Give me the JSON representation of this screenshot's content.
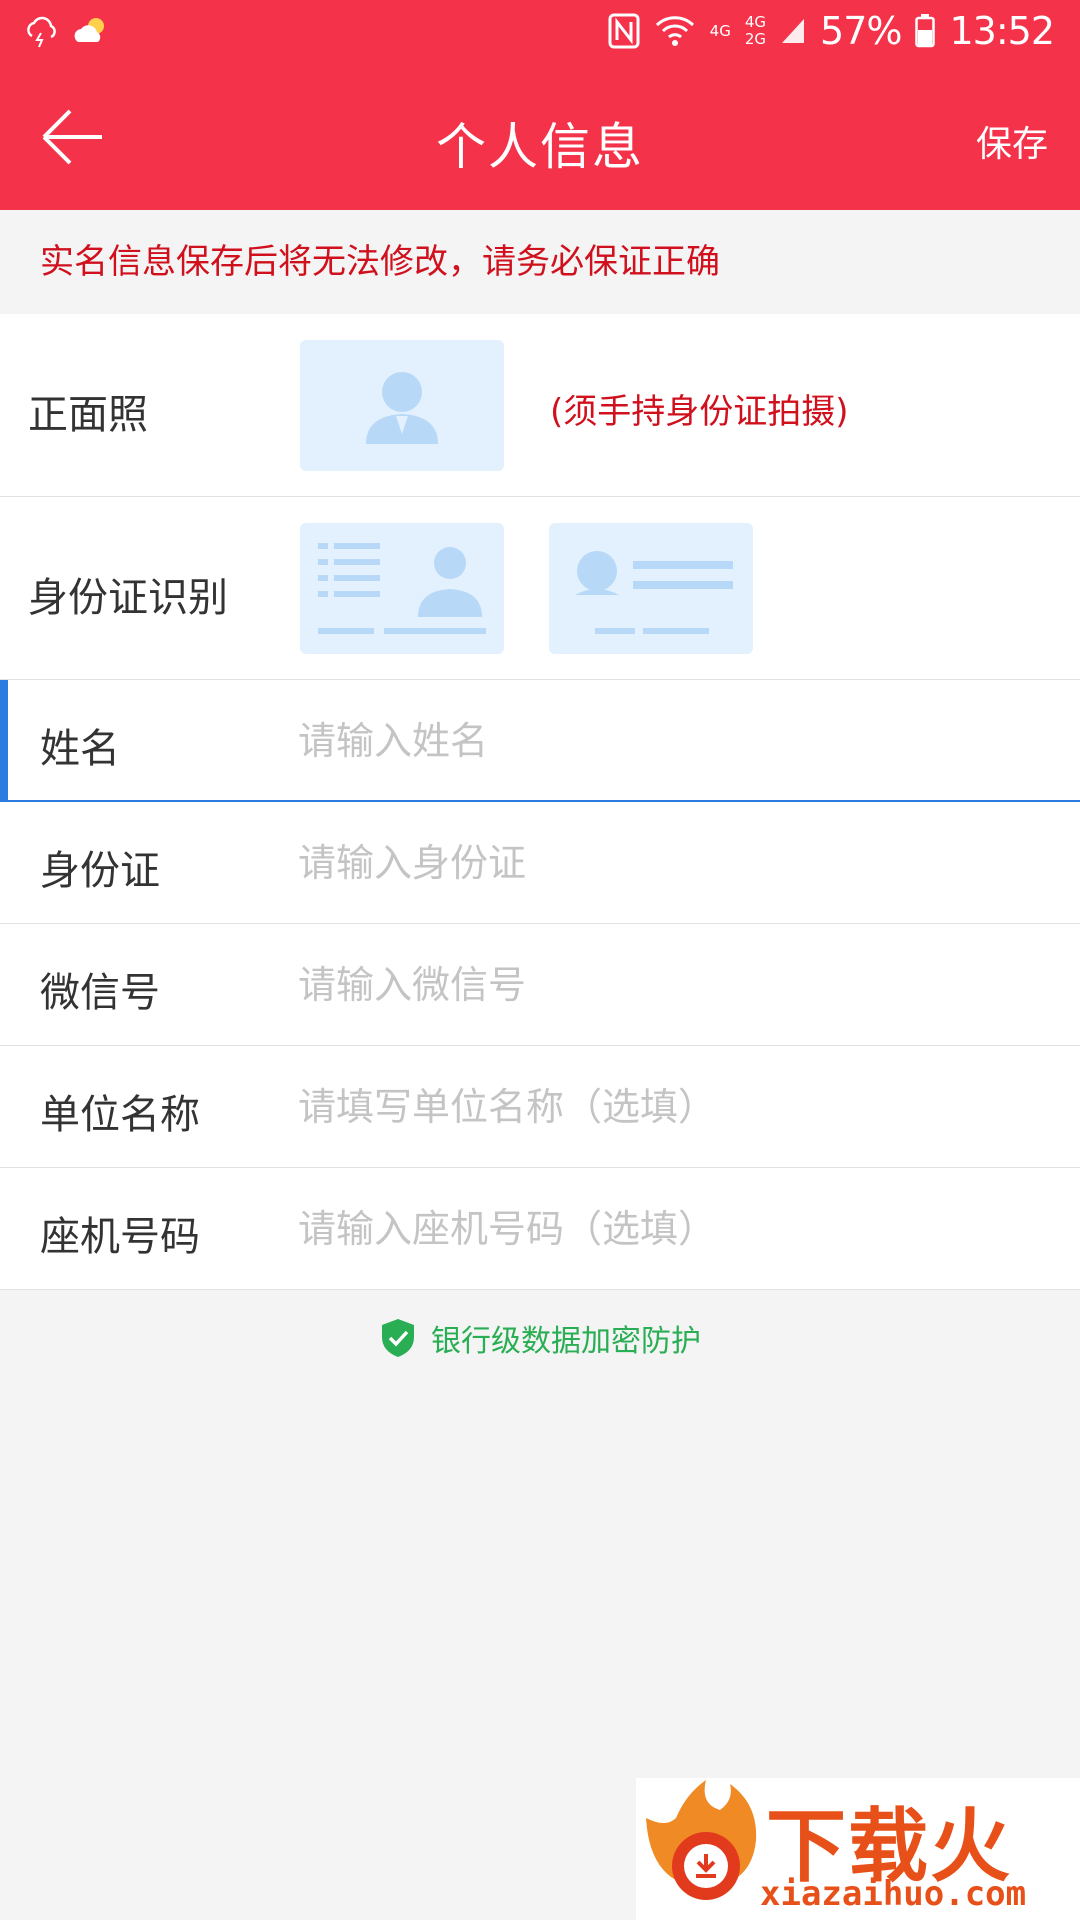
{
  "status_bar": {
    "network_top": "4G",
    "network_dual": [
      "4G",
      "2G"
    ],
    "battery": "57%",
    "time": "13:52"
  },
  "app_bar": {
    "title": "个人信息",
    "save_label": "保存"
  },
  "notice": "实名信息保存后将无法修改，请务必保证正确",
  "form": {
    "photo": {
      "label": "正面照",
      "hint": "(须手持身份证拍摄)"
    },
    "id_scan": {
      "label": "身份证识别"
    },
    "fields": [
      {
        "label": "姓名",
        "value": "",
        "placeholder": "请输入姓名"
      },
      {
        "label": "身份证",
        "value": "",
        "placeholder": "请输入身份证"
      },
      {
        "label": "微信号",
        "value": "",
        "placeholder": "请输入微信号"
      },
      {
        "label": "单位名称",
        "value": "",
        "placeholder": "请填写单位名称（选填）"
      },
      {
        "label": "座机号码",
        "value": "",
        "placeholder": "请输入座机号码（选填）"
      }
    ]
  },
  "secure_text": "银行级数据加密防护",
  "watermark": {
    "brand": "下载火",
    "site": "xiazaihuo.com"
  },
  "colors": {
    "primary": "#f4334b",
    "warning_text": "#d0101d",
    "focus": "#2c7ce0",
    "secure": "#2aae54",
    "card_bg": "#e3f0fd",
    "card_fg": "#b7d8f7"
  },
  "icons": [
    "weather-storm-icon",
    "weather-cloudy-sun-icon",
    "nfc-icon",
    "wifi-icon",
    "signal-icon",
    "battery-icon",
    "back-arrow-icon",
    "avatar-placeholder-icon",
    "id-card-front-icon",
    "id-card-back-icon",
    "shield-check-icon"
  ]
}
